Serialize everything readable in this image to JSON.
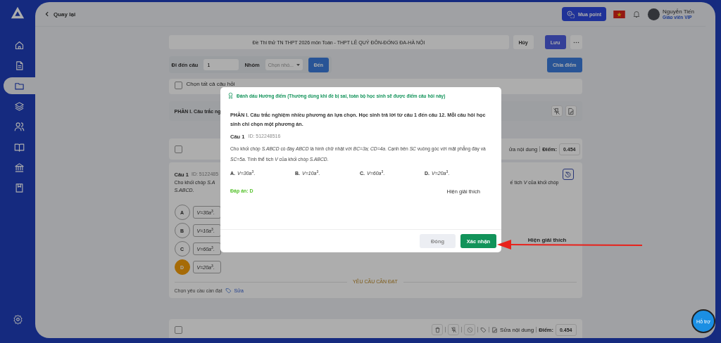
{
  "sidebar": {
    "items": [
      {
        "selected": false
      },
      {
        "selected": false
      },
      {
        "selected": true
      },
      {
        "selected": false
      },
      {
        "selected": false
      },
      {
        "selected": false
      },
      {
        "selected": false
      },
      {
        "selected": false
      }
    ]
  },
  "back_link": "Quay lại",
  "header": {
    "buy_button": "Mua point",
    "user_name": "Nguyễn Tiến",
    "user_role": "Giáo viên VIP"
  },
  "exam": {
    "title": "Đề Thi thử TN THPT 2026 môn Toán - THPT LÊ QUÝ ĐÔN-ĐỐNG ĐA-HÀ NỘI",
    "cancel_button": "Hủy",
    "save_button": "Lưu"
  },
  "navigator": {
    "label": "Đi đến câu",
    "question_value": "1",
    "group_label": "Nhóm",
    "group_placeholder": "Chọn nhó...",
    "go_button": "Đến",
    "split_button": "Chia điểm"
  },
  "select_all": {
    "label": "Chọn tất cả câu hỏi",
    "checked": false
  },
  "section_title": "PHẦN I. Câu trắc ng",
  "question_card": {
    "checked": false,
    "edit_label": "ửa nội dung",
    "score_label": "Điểm:",
    "score": "0.454",
    "number": "Câu 1",
    "id": "ID: 5122485",
    "text_left": "Cho khối chóp *S.A*",
    "text_right": "ế tích *V* của khối chóp",
    "text_line2": "*S.ABCD*.",
    "options": [
      {
        "letter": "A",
        "answer": "*V=30a*$^{3}$.",
        "selected": false
      },
      {
        "letter": "B",
        "answer": "*V=10a*$^{3}$.",
        "selected": false
      },
      {
        "letter": "C",
        "answer": "*V=60a*$^{3}$.",
        "selected": false
      },
      {
        "letter": "D",
        "answer": "*V=20a*$^{3}$.",
        "selected": true
      }
    ],
    "explain": "Hiện giải thích",
    "requirements_heading": "YÊU CẦU CẦN ĐẠT",
    "requirements_label": "Chọn yêu cầu cần đạt",
    "requirements_edit": "Sửa"
  },
  "next_card": {
    "checked": false,
    "edit_label": "Sửa nội dung",
    "score_label": "Điểm:",
    "score": "0.454"
  },
  "support_widget": "Hỗ trợ",
  "modal": {
    "title": "Đánh dấu Hướng điểm (Thường dùng khi đề bị sai, toàn bộ học sinh sẽ được điểm câu hỏi này)",
    "section_text": "PHẦN I. Câu trắc nghiệm nhiều phương án lựa chọn. Học sinh trả lời từ câu 1 đến câu 12. Mỗi câu hỏi học sinh chỉ chọn một phương án.",
    "number": "Câu 1",
    "id": "ID: 512248516",
    "question": "Cho khối chóp *S.ABCD* có đáy *ABCD* là hình chữ nhật với *BC=3a; CD=4a*. Cạnh bên *SC* vuông góc với mặt phẳng đáy và *SC=5a*. Tính thể tích *V* của khối chóp *S.ABCD*.",
    "options": [
      {
        "letter": "A.",
        "answer": "*V=30a*$^{3}$."
      },
      {
        "letter": "B.",
        "answer": "*V=10a*$^{3}$."
      },
      {
        "letter": "C.",
        "answer": "*V=60a*$^{3}$."
      },
      {
        "letter": "D.",
        "answer": "*V=20a*$^{3}$."
      }
    ],
    "answer": "Đáp án: D",
    "explain": "Hiện giải thích",
    "close_button": "Đóng",
    "confirm_button": "Xác nhận"
  }
}
